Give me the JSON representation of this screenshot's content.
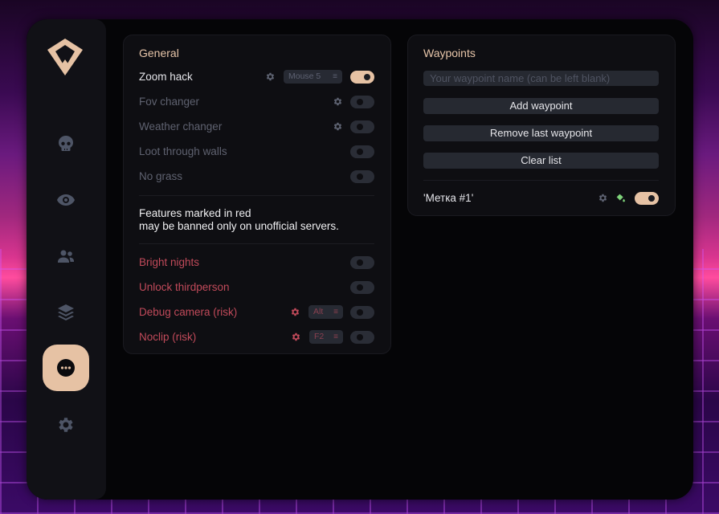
{
  "sidebar": {
    "logo": "diamond-logo",
    "items": [
      {
        "name": "visuals",
        "icon": "skull-icon",
        "active": false
      },
      {
        "name": "esp",
        "icon": "eye-icon",
        "active": false
      },
      {
        "name": "players",
        "icon": "users-icon",
        "active": false
      },
      {
        "name": "layers",
        "icon": "layers-icon",
        "active": false
      },
      {
        "name": "misc",
        "icon": "more-icon",
        "active": true
      },
      {
        "name": "settings",
        "icon": "gear-icon",
        "active": false
      }
    ]
  },
  "general": {
    "title": "General",
    "features": [
      {
        "label": "Zoom hack",
        "enabled": true,
        "keybind": "Mouse 5"
      },
      {
        "label": "Fov changer",
        "enabled": false
      },
      {
        "label": "Weather changer",
        "enabled": false
      },
      {
        "label": "Loot through walls",
        "enabled": false
      },
      {
        "label": "No grass",
        "enabled": false
      }
    ],
    "notice_line1": "Features marked in red",
    "notice_line2": "may be banned only on unofficial servers.",
    "risky": [
      {
        "label": "Bright nights",
        "enabled": false
      },
      {
        "label": "Unlock thirdperson",
        "enabled": false
      },
      {
        "label": "Debug camera (risk)",
        "enabled": false,
        "keybind": "Alt"
      },
      {
        "label": "Noclip (risk)",
        "enabled": false,
        "keybind": "F2"
      }
    ],
    "keybind_suffix": "≡"
  },
  "waypoints": {
    "title": "Waypoints",
    "name_placeholder": "Your waypoint name (can be left blank)",
    "add_label": "Add waypoint",
    "remove_label": "Remove last waypoint",
    "clear_label": "Clear list",
    "items": [
      {
        "label": "'Метка #1'",
        "enabled": true,
        "color_icon": "paint-bucket-icon",
        "accent": "#7ed37a"
      }
    ]
  },
  "colors": {
    "accent": "#e6c2a4",
    "risk": "#c14a5a"
  }
}
